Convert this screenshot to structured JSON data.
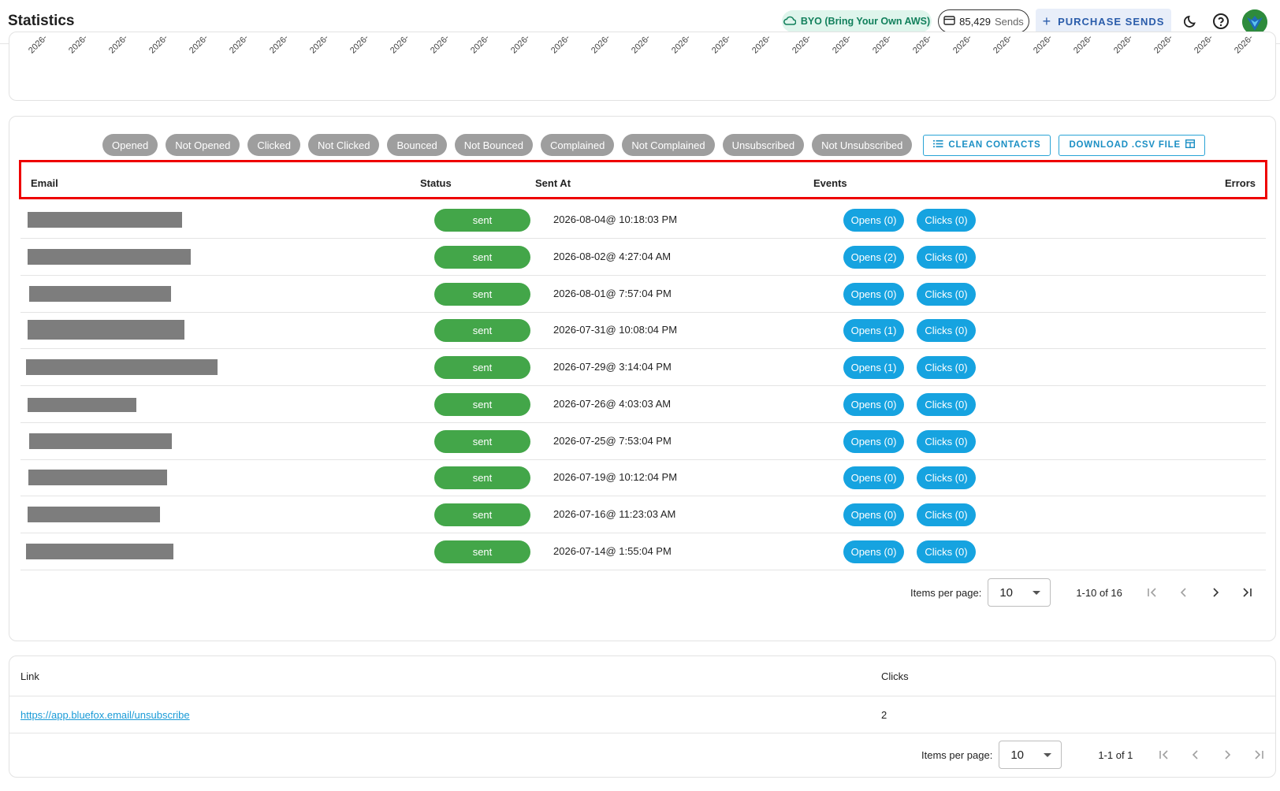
{
  "header": {
    "title": "Statistics",
    "byo_label": "BYO (Bring Your Own AWS)",
    "sends_count": "85,429",
    "sends_unit": "Sends",
    "purchase_label": "PURCHASE SENDS"
  },
  "chart_remnant": {
    "tick_label": "2026-"
  },
  "filters": [
    "Opened",
    "Not Opened",
    "Clicked",
    "Not Clicked",
    "Bounced",
    "Not Bounced",
    "Complained",
    "Not Complained",
    "Unsubscribed",
    "Not Unsubscribed"
  ],
  "actions": {
    "clean_contacts": "CLEAN CONTACTS",
    "download_csv": "DOWNLOAD .CSV FILE"
  },
  "table": {
    "headers": {
      "email": "Email",
      "status": "Status",
      "sent_at": "Sent At",
      "events": "Events",
      "errors": "Errors"
    },
    "rows": [
      {
        "status": "sent",
        "sent_at": "2026-08-04@ 10:18:03 PM",
        "opens": "Opens (0)",
        "clicks": "Clicks (0)"
      },
      {
        "status": "sent",
        "sent_at": "2026-08-02@ 4:27:04 AM",
        "opens": "Opens (2)",
        "clicks": "Clicks (0)"
      },
      {
        "status": "sent",
        "sent_at": "2026-08-01@ 7:57:04 PM",
        "opens": "Opens (0)",
        "clicks": "Clicks (0)"
      },
      {
        "status": "sent",
        "sent_at": "2026-07-31@ 10:08:04 PM",
        "opens": "Opens (1)",
        "clicks": "Clicks (0)"
      },
      {
        "status": "sent",
        "sent_at": "2026-07-29@ 3:14:04 PM",
        "opens": "Opens (1)",
        "clicks": "Clicks (0)"
      },
      {
        "status": "sent",
        "sent_at": "2026-07-26@ 4:03:03 AM",
        "opens": "Opens (0)",
        "clicks": "Clicks (0)"
      },
      {
        "status": "sent",
        "sent_at": "2026-07-25@ 7:53:04 PM",
        "opens": "Opens (0)",
        "clicks": "Clicks (0)"
      },
      {
        "status": "sent",
        "sent_at": "2026-07-19@ 10:12:04 PM",
        "opens": "Opens (0)",
        "clicks": "Clicks (0)"
      },
      {
        "status": "sent",
        "sent_at": "2026-07-16@ 11:23:03 AM",
        "opens": "Opens (0)",
        "clicks": "Clicks (0)"
      },
      {
        "status": "sent",
        "sent_at": "2026-07-14@ 1:55:04 PM",
        "opens": "Opens (0)",
        "clicks": "Clicks (0)"
      }
    ],
    "pager": {
      "label": "Items per page:",
      "per_page": "10",
      "range": "1-10 of 16"
    }
  },
  "links": {
    "headers": {
      "link": "Link",
      "clicks": "Clicks"
    },
    "rows": [
      {
        "url": "https://app.bluefox.email/unsubscribe",
        "clicks": "2"
      }
    ],
    "pager": {
      "label": "Items per page:",
      "per_page": "10",
      "range": "1-1 of 1"
    }
  },
  "icons": {
    "byo": "cloud-icon",
    "sends": "credit-card-icon",
    "theme": "moon-icon",
    "help": "help-icon",
    "clean": "list-icon",
    "csv": "table-icon"
  },
  "colors": {
    "sent_green": "#43a649",
    "event_blue": "#16a3e0",
    "highlight_red": "#ee0000",
    "filter_grey": "#9e9e9e"
  }
}
